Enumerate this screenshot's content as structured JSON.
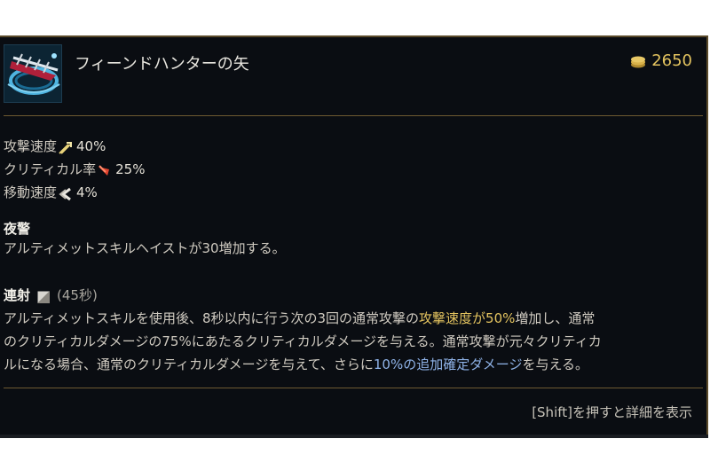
{
  "item": {
    "name": "フィーンドハンターの矢",
    "cost": "2650",
    "icon": "fiend-arrow-icon"
  },
  "stats": [
    {
      "label": "攻撃速度",
      "icon": "attack-speed-icon",
      "value": "40%"
    },
    {
      "label": "クリティカル率",
      "icon": "crit-chance-icon",
      "value": "25%"
    },
    {
      "label": "移動速度",
      "icon": "move-speed-icon",
      "value": "4%"
    }
  ],
  "passive": {
    "name": "夜警",
    "description": "アルティメットスキルヘイストが30増加する。"
  },
  "active": {
    "name": "連射",
    "cooldown": "(45秒)",
    "desc_parts": [
      "アルティメットスキルを使用後、8秒以内に行う次の3回の通常攻撃の",
      "攻撃速度が50%",
      "増加し、通常",
      "のクリティカルダメージの75%にあたるクリティカルダメージを与える。通常攻撃が元々クリティカ",
      "ルになる場合、通常のクリティカルダメージを与えて、さらに",
      "10%の追加確定ダメージ",
      "を与える。"
    ]
  },
  "footer": {
    "hint": "[Shift]を押すと詳細を表示"
  },
  "colors": {
    "gold": "#e3c35f",
    "true_damage_blue": "#8fb3e8",
    "panel_bg": "#0a0d12",
    "divider": "#6e5a31"
  }
}
